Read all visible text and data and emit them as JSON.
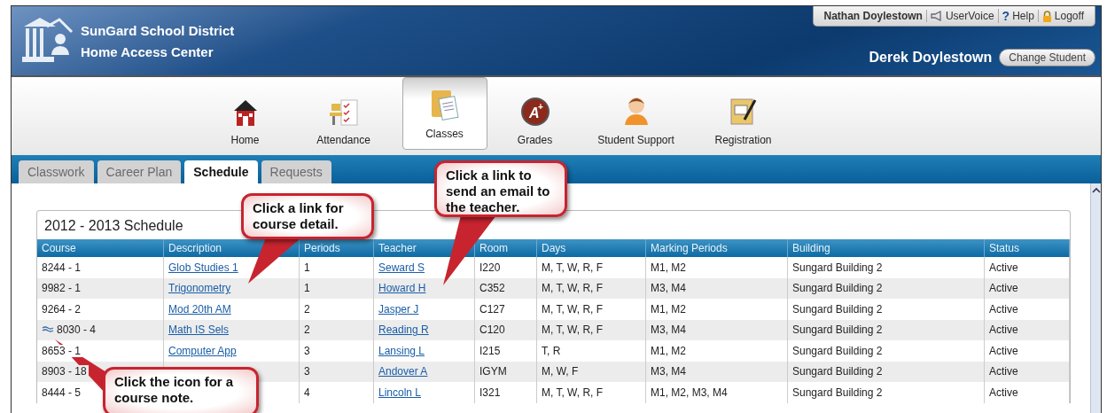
{
  "header": {
    "district": "SunGard School District",
    "product": "Home Access Center",
    "user_bar": [
      {
        "kind": "user",
        "label": "Nathan Doylestown"
      },
      {
        "kind": "uservoice",
        "label": "UserVoice"
      },
      {
        "kind": "help",
        "icon": "?",
        "label": "Help"
      },
      {
        "kind": "logoff",
        "label": "Logoff"
      }
    ],
    "student": "Derek Doylestown",
    "change_button": "Change Student"
  },
  "nav": [
    {
      "kind": "home",
      "label": "Home",
      "selected": false
    },
    {
      "kind": "attendance",
      "label": "Attendance",
      "selected": false
    },
    {
      "kind": "classes",
      "label": "Classes",
      "selected": true
    },
    {
      "kind": "grades",
      "badge": "A",
      "badge_sup": "+",
      "label": "Grades",
      "selected": false
    },
    {
      "kind": "support",
      "label": "Student Support",
      "selected": false
    },
    {
      "kind": "registration",
      "label": "Registration",
      "selected": false
    }
  ],
  "tabs": [
    {
      "label": "Classwork",
      "selected": false
    },
    {
      "label": "Career Plan",
      "selected": false
    },
    {
      "label": "Schedule",
      "selected": true
    },
    {
      "label": "Requests",
      "selected": false
    }
  ],
  "schedule": {
    "title": "2012 - 2013 Schedule",
    "columns": [
      "Course",
      "Description",
      "Periods",
      "Teacher",
      "Room",
      "Days",
      "Marking Periods",
      "Building",
      "Status"
    ],
    "rows": [
      {
        "course": "8244 - 1",
        "note": false,
        "description": "Glob Studies 1",
        "periods": "1",
        "teacher": "Seward S",
        "room": "I220",
        "days": "M, T, W, R, F",
        "marking_periods": "M1, M2",
        "building": "Sungard Building 2",
        "status": "Active"
      },
      {
        "course": "9982 - 1",
        "note": false,
        "description": "Trigonometry",
        "periods": "1",
        "teacher": "Howard H",
        "room": "C352",
        "days": "M, T, W, R, F",
        "marking_periods": "M3, M4",
        "building": "Sungard Building 2",
        "status": "Active"
      },
      {
        "course": "9264 - 2",
        "note": false,
        "description": "Mod 20th AM",
        "periods": "2",
        "teacher": "Jasper J",
        "room": "C127",
        "days": "M, T, W, R, F",
        "marking_periods": "M1, M2",
        "building": "Sungard Building 2",
        "status": "Active"
      },
      {
        "course": "8030 - 4",
        "note": true,
        "description": "Math IS Sels",
        "periods": "2",
        "teacher": "Reading R",
        "room": "C120",
        "days": "M, T, W, R, F",
        "marking_periods": "M3, M4",
        "building": "Sungard Building 2",
        "status": "Active"
      },
      {
        "course": "8653 - 1",
        "note": false,
        "description": "Computer App",
        "periods": "3",
        "teacher": "Lansing L",
        "room": "I215",
        "days": "T, R",
        "marking_periods": "M1, M2",
        "building": "Sungard Building 2",
        "status": "Active"
      },
      {
        "course": "8903 - 18",
        "note": false,
        "periods": "3",
        "teacher": "Andover A",
        "room": "IGYM",
        "days": "M, W, F",
        "marking_periods": "M3, M4",
        "building": "Sungard Building 2",
        "status": "Active"
      },
      {
        "course": "8444 - 5",
        "note": false,
        "periods": "4",
        "teacher": "Lincoln L",
        "room": "I321",
        "days": "M, T, W, R, F",
        "marking_periods": "M1, M2, M3, M4",
        "building": "Sungard Building 2",
        "status": "Active"
      }
    ]
  },
  "callouts": [
    "Click a link for course detail.",
    "Click a link to send an email to the teacher.",
    "Click the icon for a course note."
  ]
}
